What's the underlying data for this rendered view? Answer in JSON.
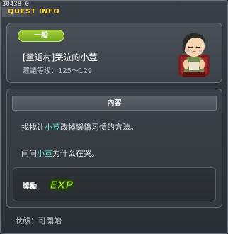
{
  "window": {
    "id_code": "30438-0",
    "title": "QUEST INFO"
  },
  "quest": {
    "category_badge": "一般",
    "name": "[童话村]哭泣的小荳",
    "level_label": "建議等级：",
    "level_range": "125～129",
    "npc_icon": "crying-child-npc-icon"
  },
  "content": {
    "header": "內容",
    "line1": {
      "pre": "找找让",
      "highlight": "小荳",
      "post": "改掉懒惰习惯的方法。"
    },
    "line2": {
      "pre": "问问",
      "highlight": "小荳",
      "post": "为什么在哭。"
    },
    "reward_label": "獎勵",
    "reward_icon": "exp-icon",
    "reward_icon_text": "EXP"
  },
  "status": {
    "text": "狀態：可開始"
  },
  "colors": {
    "title": "#ffd24a",
    "badge": "#8cc02b",
    "highlight": "#6fe0d4"
  }
}
